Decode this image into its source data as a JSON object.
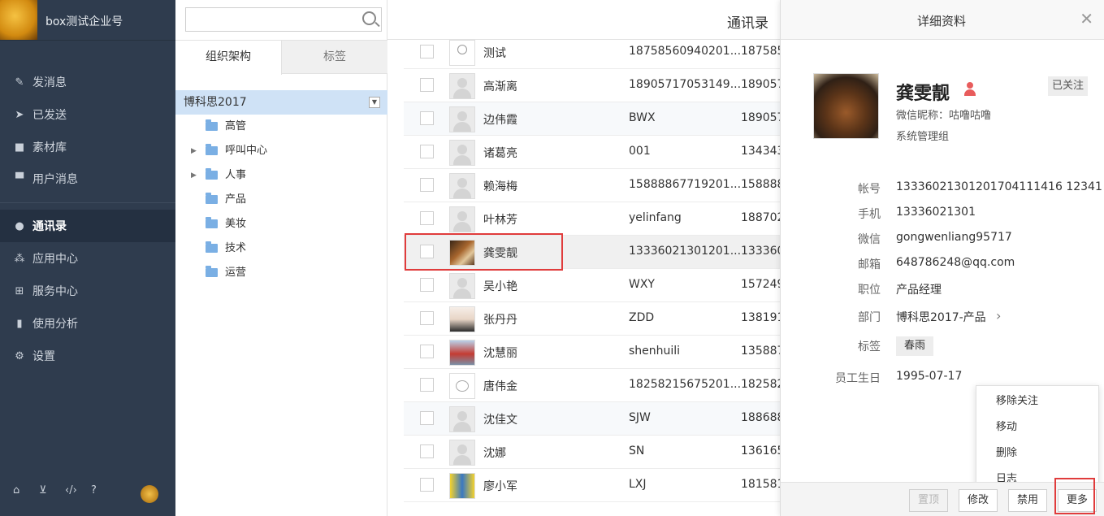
{
  "brand": {
    "name": "box测试企业号"
  },
  "nav": [
    {
      "label": "发消息",
      "icon": "pencil-icon"
    },
    {
      "label": "已发送",
      "icon": "send-icon"
    },
    {
      "label": "素材库",
      "icon": "briefcase-icon"
    },
    {
      "label": "用户消息",
      "icon": "chat-icon"
    },
    {
      "label": "通讯录",
      "icon": "user-icon",
      "active": true
    },
    {
      "label": "应用中心",
      "icon": "apps-icon"
    },
    {
      "label": "服务中心",
      "icon": "chip-icon"
    },
    {
      "label": "使用分析",
      "icon": "bar-chart-icon"
    },
    {
      "label": "设置",
      "icon": "gear-icon"
    }
  ],
  "footer_icons": [
    "home-icon",
    "cart-icon",
    "code-icon",
    "help-icon",
    "avatar"
  ],
  "search": {
    "placeholder": ""
  },
  "org_tabs": [
    "组织架构",
    "标签"
  ],
  "org_root": "博科思2017",
  "departments": [
    {
      "label": "高管",
      "expandable": false
    },
    {
      "label": "呼叫中心",
      "expandable": true
    },
    {
      "label": "人事",
      "expandable": true
    },
    {
      "label": "产品",
      "expandable": false
    },
    {
      "label": "美妆",
      "expandable": false
    },
    {
      "label": "技术",
      "expandable": false
    },
    {
      "label": "运营",
      "expandable": false
    }
  ],
  "list": {
    "title": "通讯录",
    "rows": [
      {
        "name": "测试",
        "account": "18758560940201...",
        "phone": "187585"
      },
      {
        "name": "高渐离",
        "account": "18905717053149...",
        "phone": "189057"
      },
      {
        "name": "边伟霞",
        "account": "BWX",
        "phone": "189057"
      },
      {
        "name": "诸葛亮",
        "account": "001",
        "phone": "134343"
      },
      {
        "name": "赖海梅",
        "account": "15888867719201...",
        "phone": "158888"
      },
      {
        "name": "叶林芳",
        "account": "yelinfang",
        "phone": "188702"
      },
      {
        "name": "龚雯靓",
        "account": "13336021301201...",
        "phone": "133360"
      },
      {
        "name": "吴小艳",
        "account": "WXY",
        "phone": "157249"
      },
      {
        "name": "张丹丹",
        "account": "ZDD",
        "phone": "138191"
      },
      {
        "name": "沈慧丽",
        "account": "shenhuili",
        "phone": "135887"
      },
      {
        "name": "唐伟金",
        "account": "18258215675201...",
        "phone": "182582"
      },
      {
        "name": "沈佳文",
        "account": "SJW",
        "phone": "188688"
      },
      {
        "name": "沈娜",
        "account": "SN",
        "phone": "136165"
      },
      {
        "name": "廖小军",
        "account": "LXJ",
        "phone": "181581"
      }
    ]
  },
  "detail": {
    "title": "详细资料",
    "name": "龚雯靓",
    "followed": "已关注",
    "nickname": "微信昵称：咕噜咕噜",
    "role": "系统管理组",
    "fields": [
      {
        "key": "帐号",
        "value": "13336021301201704111416 12341"
      },
      {
        "key": "手机",
        "value": "13336021301"
      },
      {
        "key": "微信",
        "value": "gongwenliang95717"
      },
      {
        "key": "邮箱",
        "value": "648786248@qq.com"
      },
      {
        "key": "职位",
        "value": "产品经理"
      },
      {
        "key": "部门",
        "value": "博科思2017-产品"
      },
      {
        "key": "标签",
        "value": "春雨"
      },
      {
        "key": "员工生日",
        "value": "1995-07-17"
      }
    ],
    "menu": [
      "移除关注",
      "移动",
      "删除",
      "日志"
    ],
    "buttons": {
      "pin": "置顶",
      "edit": "修改",
      "disable": "禁用",
      "more": "更多"
    }
  }
}
